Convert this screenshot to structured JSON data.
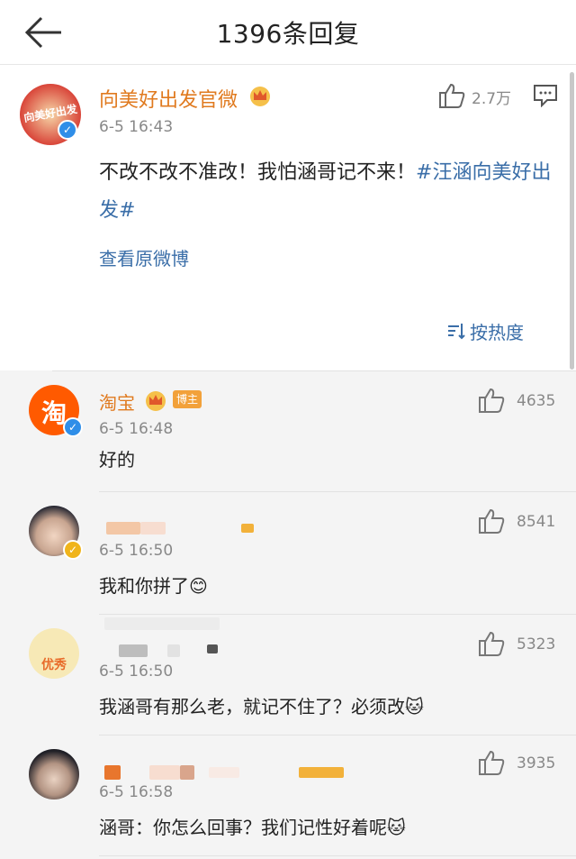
{
  "header": {
    "title": "1396条回复",
    "back_icon": "back-arrow-icon"
  },
  "post": {
    "author": "向美好出发官微",
    "avatar_text": "向美好出发",
    "time": "6-5 16:43",
    "likes": "2.7万",
    "content_text": "不改不改不准改！我怕涵哥记不来！",
    "hashtag": "#汪涵向美好出发#",
    "view_original": "查看原微博",
    "sort_label": "按热度"
  },
  "comments": [
    {
      "author": "淘宝",
      "badge": "博主",
      "avatar_text": "淘",
      "time": "6-5 16:48",
      "likes": "4635",
      "text": "好的"
    },
    {
      "author": "",
      "time": "6-5 16:50",
      "likes": "8541",
      "text": "我和你拼了😊"
    },
    {
      "author": "",
      "avatar_text": "优秀",
      "time": "6-5 16:50",
      "likes": "5323",
      "text": "我涵哥有那么老，就记不住了？必须改🐱"
    },
    {
      "author": "",
      "time": "6-5 16:58",
      "likes": "3935",
      "text": "涵哥：你怎么回事？我们记性好着呢🐱"
    }
  ],
  "colors": {
    "accent_orange": "#e07a1f",
    "link_blue": "#3a6ea8",
    "verified_blue": "#2f8ee8"
  }
}
